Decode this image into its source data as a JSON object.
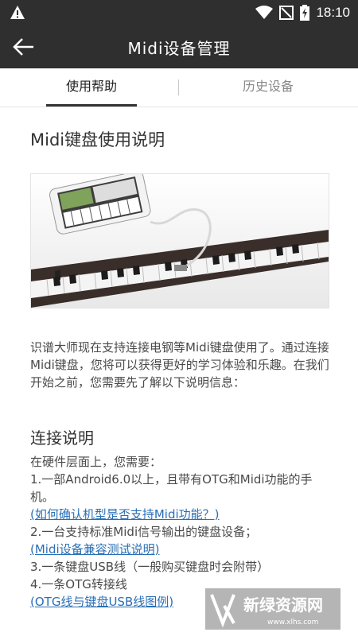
{
  "status_bar": {
    "time": "18:10",
    "icons": [
      "warning-icon",
      "wifi-icon",
      "no-signal-icon",
      "battery-charging-icon"
    ]
  },
  "app_bar": {
    "title": "Midi设备管理",
    "back_icon": "back-arrow-icon"
  },
  "tabs": [
    {
      "label": "使用帮助",
      "active": true
    },
    {
      "label": "历史设备",
      "active": false
    }
  ],
  "content": {
    "title": "Midi键盘使用说明",
    "intro": "识谱大师现在支持连接电钢等Midi键盘使用了。通过连接Midi键盘，您将可以获得更好的学习体验和乐趣。在我们开始之前，您需要先了解以下说明信息：",
    "connect_title": "连接说明",
    "items": [
      {
        "text": "在硬件层面上，您需要：",
        "link": false
      },
      {
        "text": "1.一部Android6.0以上，且带有OTG和Midi功能的手机。",
        "link": false
      },
      {
        "text": "(如何确认机型是否支持Midi功能？)",
        "link": true
      },
      {
        "text": "2.一台支持标准Midi信号输出的键盘设备；",
        "link": false
      },
      {
        "text": "(Midi设备兼容测试说明)",
        "link": true
      },
      {
        "text": "3.一条键盘USB线（一般购买键盘时会附带）",
        "link": false
      },
      {
        "text": "4.一条OTG转接线",
        "link": false
      },
      {
        "text": "(OTG线与键盘USB线图例)",
        "link": true
      }
    ]
  },
  "watermark": {
    "text": "新绿资源网",
    "url_text": "www.xlhs.com"
  },
  "colors": {
    "bar_bg": "#2f2f2f",
    "link": "#2a6fb5",
    "text": "#4a4a4a"
  }
}
